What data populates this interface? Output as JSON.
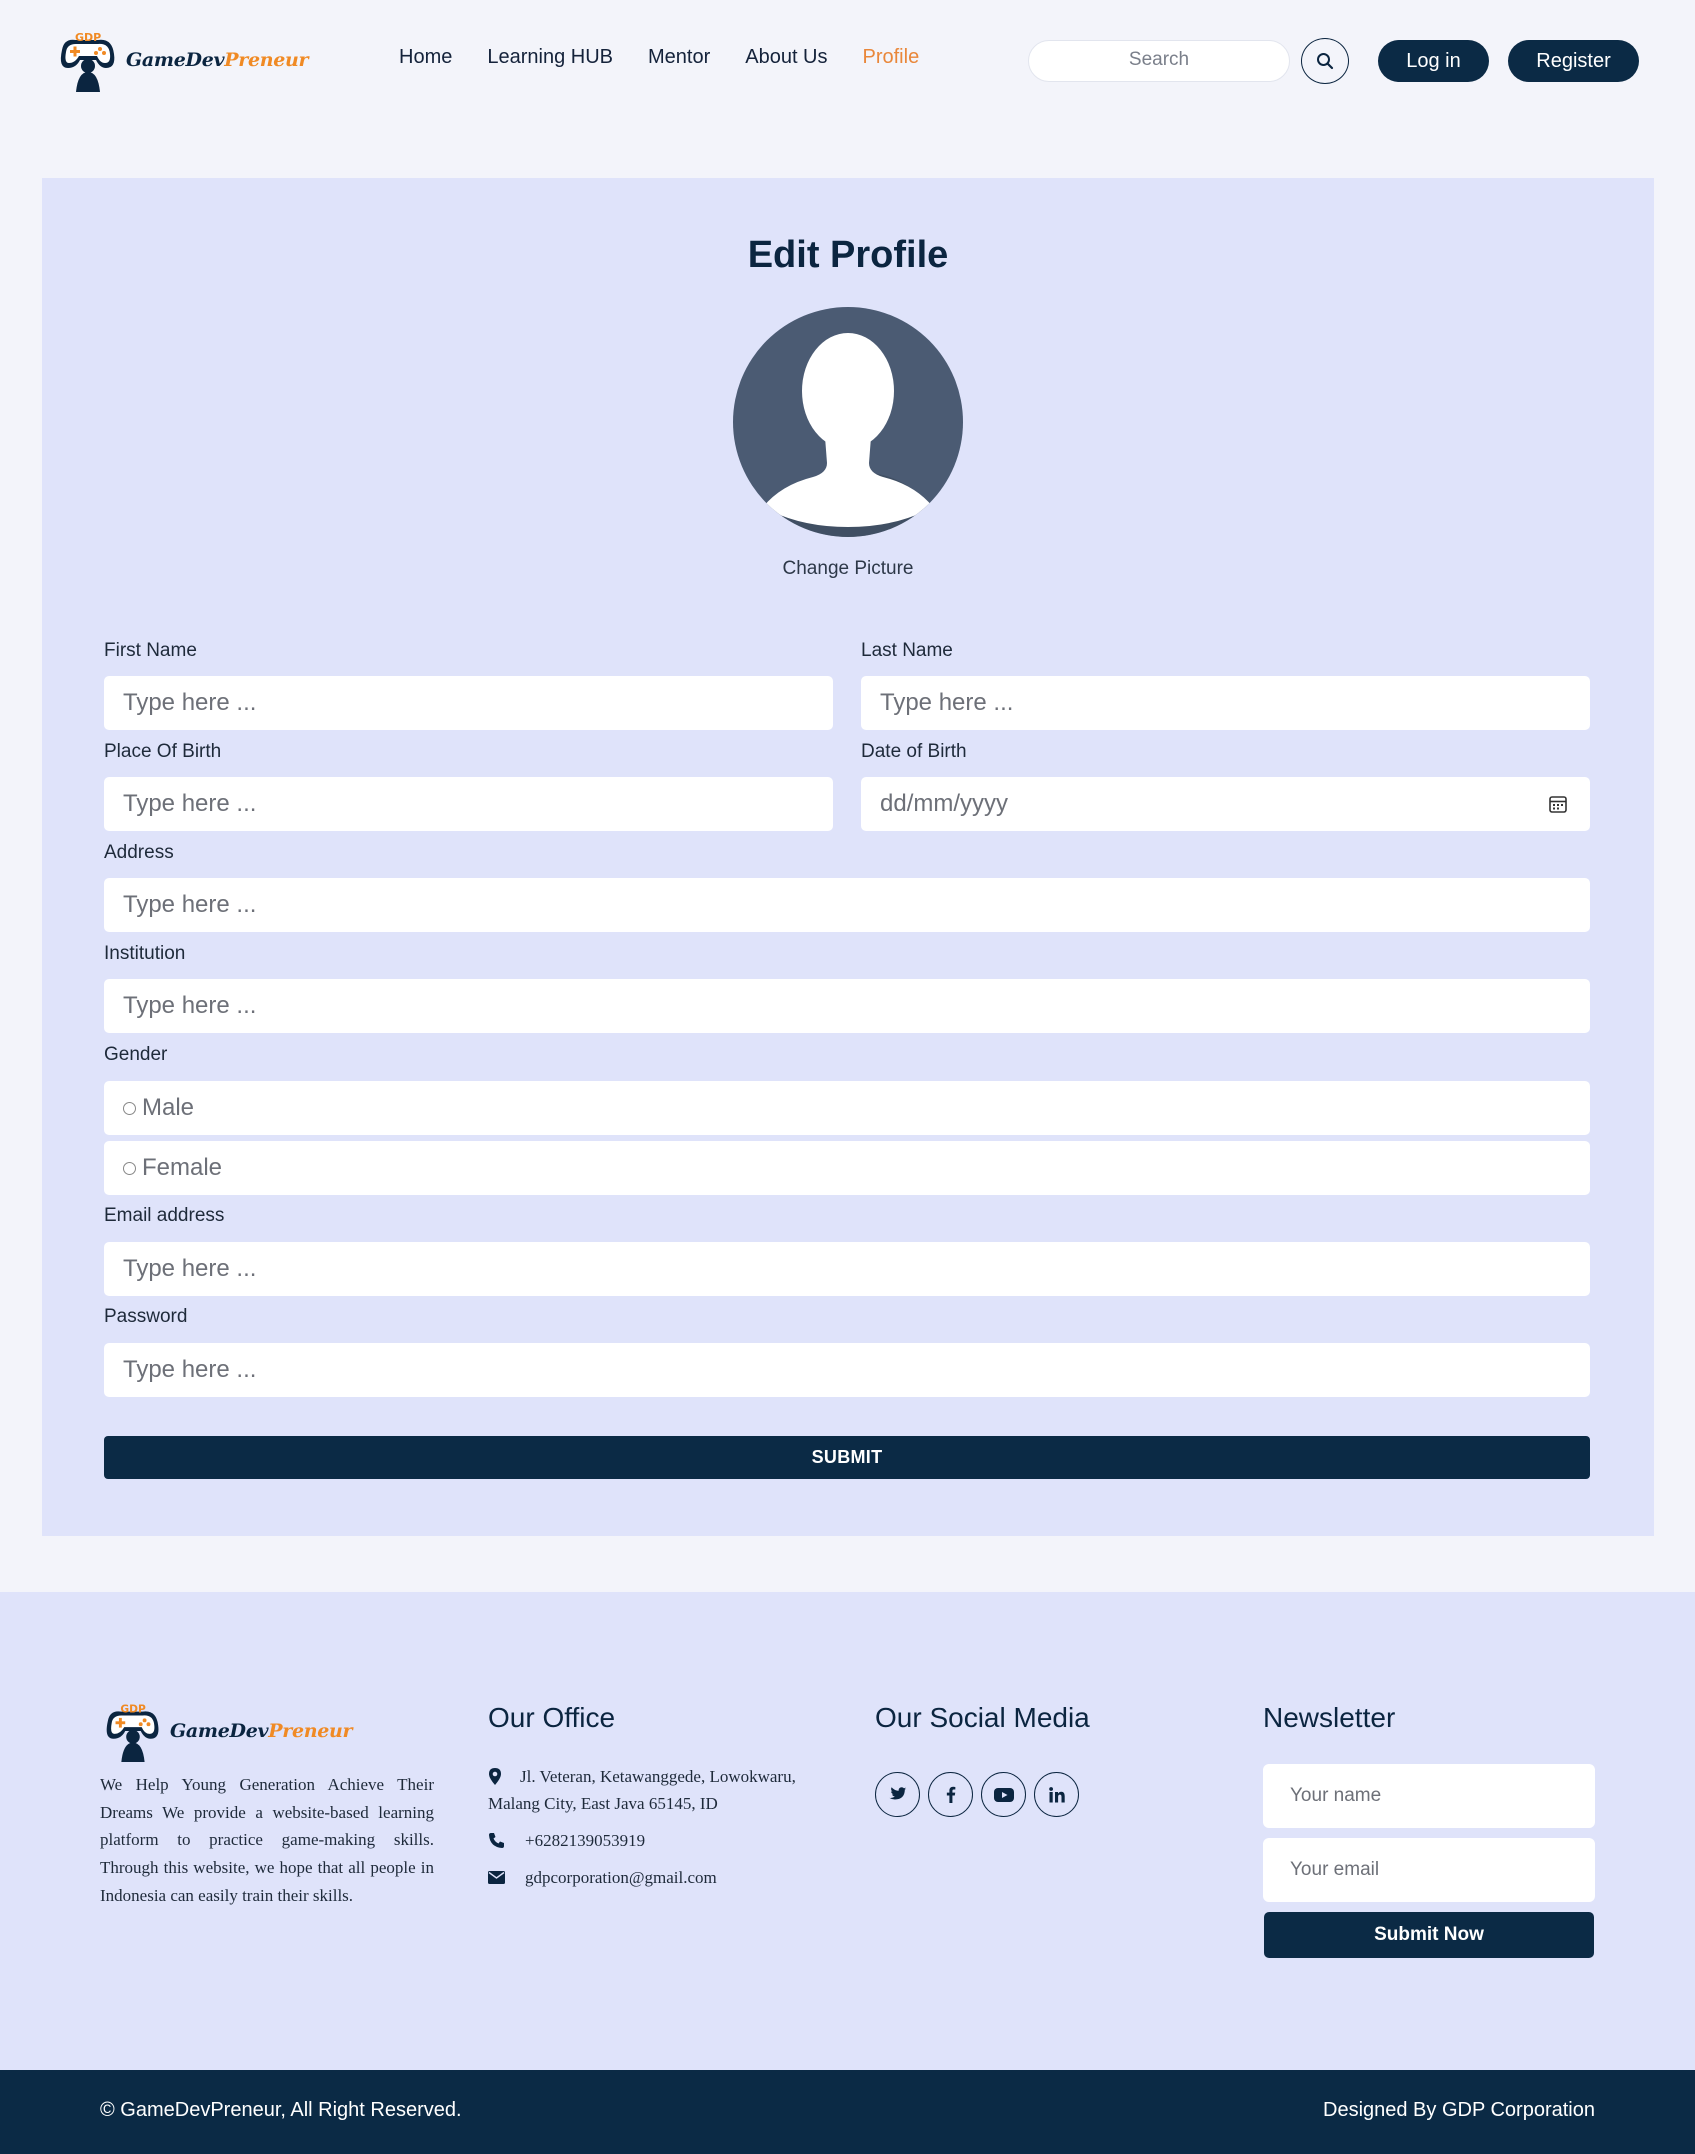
{
  "header": {
    "logo": {
      "part1": "GameDev",
      "part2": "Preneur",
      "badge": "GDP"
    },
    "nav": [
      {
        "label": "Home",
        "active": false
      },
      {
        "label": "Learning HUB",
        "active": false
      },
      {
        "label": "Mentor",
        "active": false
      },
      {
        "label": "About Us",
        "active": false
      },
      {
        "label": "Profile",
        "active": true
      }
    ],
    "search": {
      "placeholder": "Search",
      "icon": "search-icon"
    },
    "login_label": "Log in",
    "register_label": "Register"
  },
  "form": {
    "title": "Edit Profile",
    "change_picture": "Change Picture",
    "first_name": {
      "label": "First Name",
      "placeholder": "Type here ..."
    },
    "last_name": {
      "label": "Last Name",
      "placeholder": "Type here ..."
    },
    "place_of_birth": {
      "label": "Place Of Birth",
      "placeholder": "Type here ..."
    },
    "date_of_birth": {
      "label": "Date of Birth",
      "placeholder": "dd/mm/yyyy",
      "icon": "calendar-icon"
    },
    "address": {
      "label": "Address",
      "placeholder": "Type here ..."
    },
    "institution": {
      "label": "Institution",
      "placeholder": "Type here ..."
    },
    "gender": {
      "label": "Gender",
      "options": [
        "Male",
        "Female"
      ],
      "selected": null
    },
    "email": {
      "label": "Email address",
      "placeholder": "Type here ..."
    },
    "password": {
      "label": "Password",
      "placeholder": "Type here ..."
    },
    "submit_label": "SUBMIT"
  },
  "footer": {
    "logo": {
      "part1": "GameDev",
      "part2": "Preneur",
      "badge": "GDP"
    },
    "about": "We Help Young Generation Achieve Their Dreams We provide a website-based learning platform to practice game-making skills. Through this website, we hope that all people in Indonesia can easily train their skills.",
    "office": {
      "heading": "Our Office",
      "address_line1": "Jl. Veteran, Ketawanggede, Lowokwaru,",
      "address_line2": "Malang City, East Java 65145, ID",
      "phone": "+6282139053919",
      "email": "gdpcorporation@gmail.com"
    },
    "social": {
      "heading": "Our Social Media",
      "icons": [
        "twitter-icon",
        "facebook-icon",
        "youtube-icon",
        "linkedin-icon"
      ]
    },
    "newsletter": {
      "heading": "Newsletter",
      "name_placeholder": "Your name",
      "email_placeholder": "Your email",
      "button_label": "Submit Now"
    },
    "copyright": "© GameDevPreneur, All Right Reserved.",
    "designed_by": "Designed By GDP Corporation"
  },
  "colors": {
    "navy": "#0b2a45",
    "orange": "#e9873a",
    "panel": "#dfe3fa",
    "page_bg": "#f3f4fa",
    "avatar_bg": "#4b5b73"
  }
}
